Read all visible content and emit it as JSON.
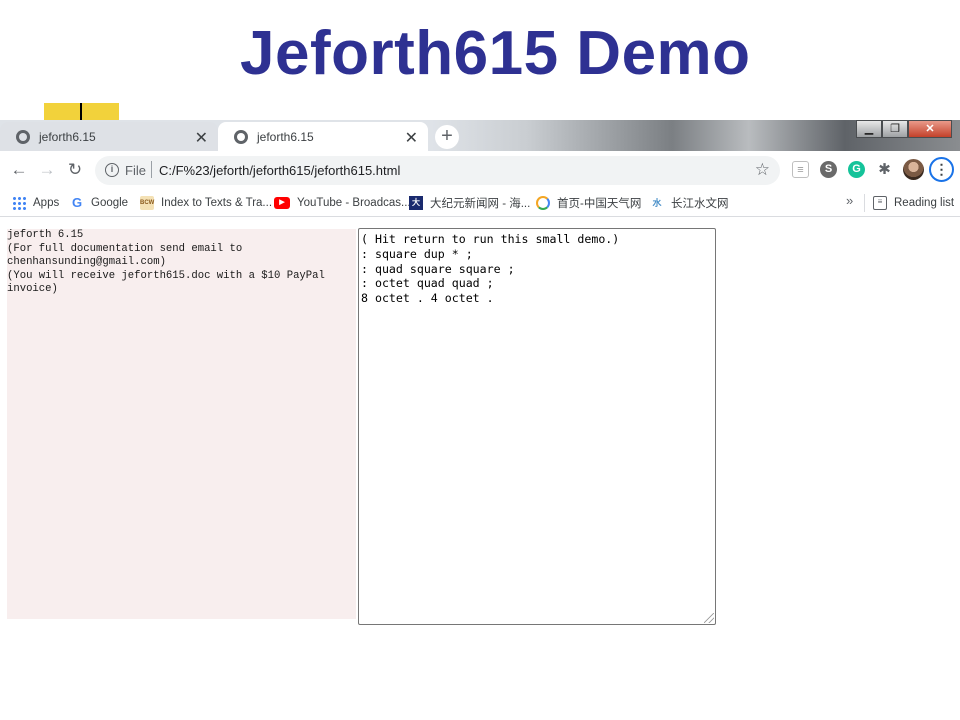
{
  "slide": {
    "title": "Jeforth615 Demo"
  },
  "tabs": [
    {
      "label": "jeforth6.15",
      "close": "✕"
    },
    {
      "label": "jeforth6.15",
      "close": "✕"
    }
  ],
  "new_tab": "+",
  "window_controls": {
    "minimize": "▁",
    "maximize": "❐",
    "close": "✕"
  },
  "toolbar": {
    "back": "←",
    "forward": "→",
    "reload": "↻",
    "info": "i",
    "scheme": "File",
    "url": "C:/F%23/jeforth/jeforth615/jeforth615.html",
    "star": "☆",
    "menu": "⋮"
  },
  "extensions": {
    "clip": "≡",
    "skype": "S",
    "grammarly": "G",
    "puzzle": "✱"
  },
  "bookmarks": [
    {
      "label": "Apps",
      "icon": "apps-grid-icon"
    },
    {
      "label": "Google",
      "icon": "google-icon",
      "glyph": "G"
    },
    {
      "label": "Index to Texts & Tra...",
      "icon": "bcw-icon",
      "glyph": "BCW"
    },
    {
      "label": "YouTube - Broadcas...",
      "icon": "youtube-icon",
      "glyph": "▶"
    },
    {
      "label": "大纪元新闻网 - 海...",
      "icon": "epoch-times-icon",
      "glyph": "大"
    },
    {
      "label": "首页-中国天气网",
      "icon": "weather-icon",
      "glyph": ""
    },
    {
      "label": "长江水文网",
      "icon": "water-icon",
      "glyph": "水"
    }
  ],
  "bookmarks_overflow": "»",
  "reading_list": "Reading list",
  "reading_list_glyph": "≡",
  "output_text": "jeforth 6.15\n(For full documentation send email to\nchenhansunding@gmail.com)\n(You will receive jeforth615.doc with a $10 PayPal\ninvoice)",
  "input_text": "( Hit return to run this small demo.)\n: square dup * ;\n: quad square square ;\n: octet quad quad ;\n8 octet . 4 octet .",
  "colors": {
    "title": "#2e3192",
    "output_bg": "#f8eeee",
    "accent": "#1a73e8"
  }
}
